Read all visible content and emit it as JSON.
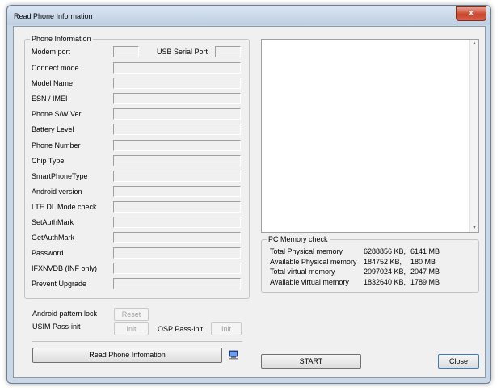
{
  "window": {
    "title": "Read Phone Information",
    "close_glyph": "x"
  },
  "phone_info": {
    "group_title": "Phone Information",
    "modem_port_label": "Modem port",
    "usb_serial_port_label": "USB Serial Port",
    "fields": [
      {
        "label": "Connect mode",
        "value": ""
      },
      {
        "label": "Model Name",
        "value": ""
      },
      {
        "label": "ESN / IMEI",
        "value": ""
      },
      {
        "label": "Phone S/W Ver",
        "value": ""
      },
      {
        "label": "Battery Level",
        "value": ""
      },
      {
        "label": "Phone Number",
        "value": ""
      },
      {
        "label": "Chip Type",
        "value": ""
      },
      {
        "label": "SmartPhoneType",
        "value": ""
      },
      {
        "label": "Android version",
        "value": ""
      },
      {
        "label": "LTE DL Mode check",
        "value": ""
      },
      {
        "label": "SetAuthMark",
        "value": ""
      },
      {
        "label": "GetAuthMark",
        "value": ""
      },
      {
        "label": "Password",
        "value": ""
      },
      {
        "label": "IFXNVDB (INF only)",
        "value": ""
      },
      {
        "label": "Prevent Upgrade",
        "value": ""
      }
    ]
  },
  "android_pattern_lock": {
    "label": "Android pattern lock",
    "button": "Reset"
  },
  "usim_pass_init": {
    "label": "USIM Pass-init",
    "button": "Init"
  },
  "osp_pass_init": {
    "label": "OSP Pass-init",
    "button": "Init"
  },
  "read_button": "Read Phone Infomation",
  "pc_icon": "computer-icon",
  "memory": {
    "group_title": "PC Memory check",
    "rows": [
      {
        "label": "Total Physical memory",
        "kb": "6288856 KB,",
        "mb": "6141 MB"
      },
      {
        "label": "Available Physical memory",
        "kb": "184752 KB,",
        "mb": "180 MB"
      },
      {
        "label": "Total virtual memory",
        "kb": "2097024 KB,",
        "mb": "2047 MB"
      },
      {
        "label": "Available virtual memory",
        "kb": "1832640 KB,",
        "mb": "1789 MB"
      }
    ]
  },
  "start_button": "START",
  "close_button": "Close"
}
